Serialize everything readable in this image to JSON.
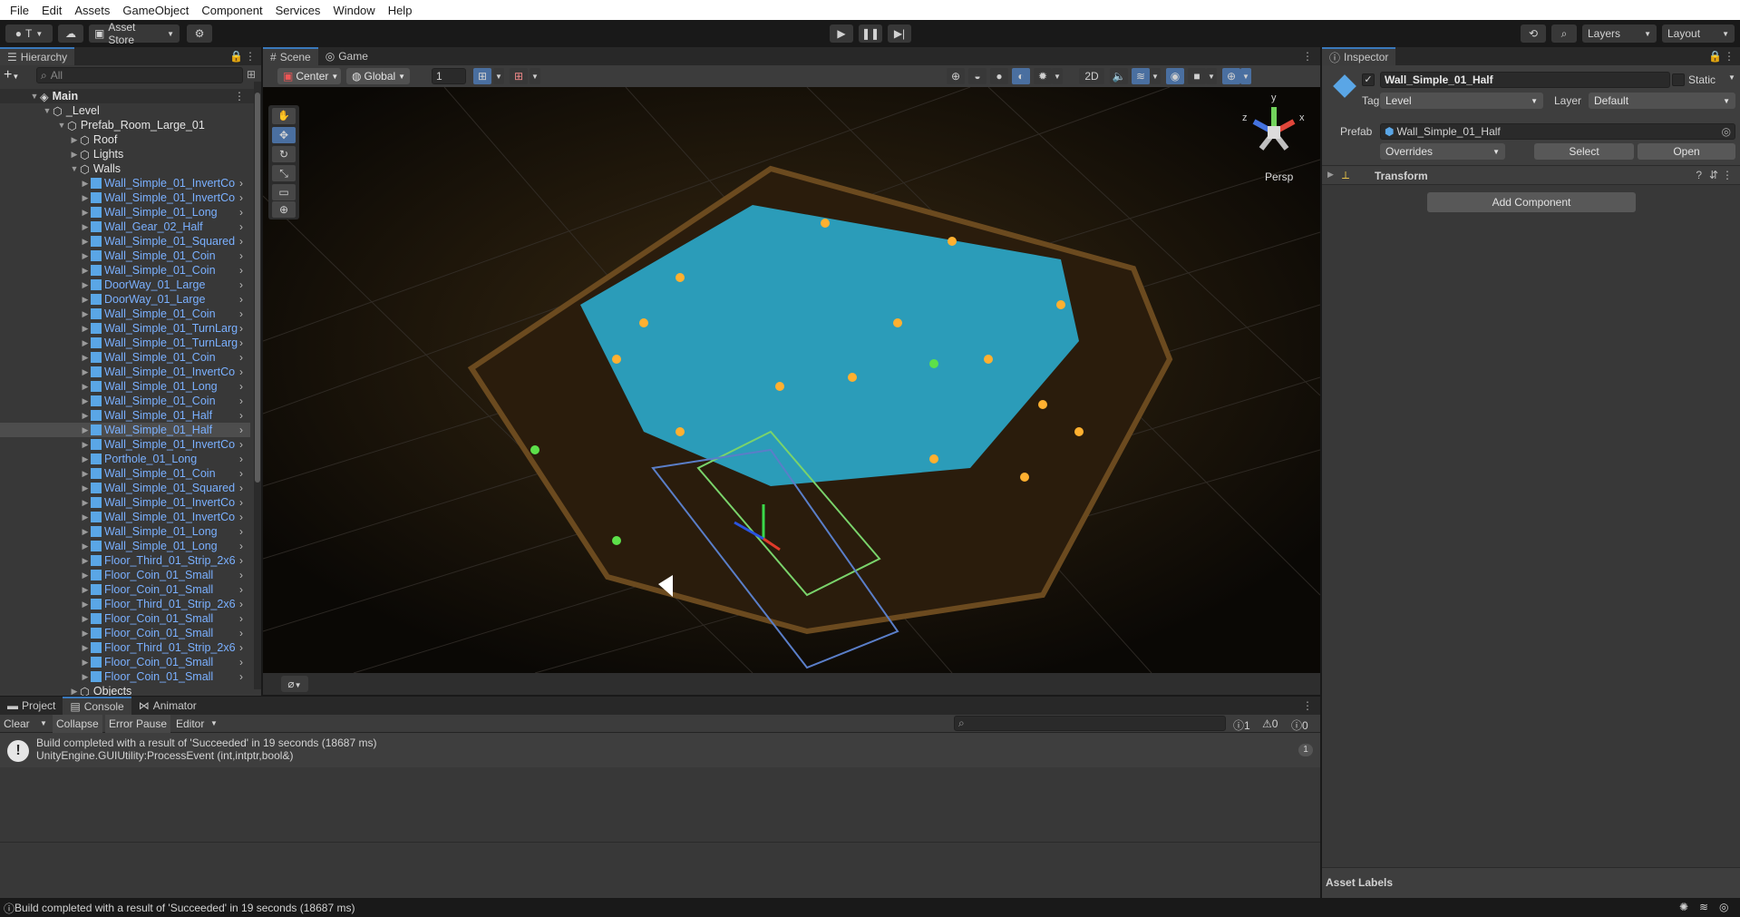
{
  "menu": [
    "File",
    "Edit",
    "Assets",
    "GameObject",
    "Component",
    "Services",
    "Window",
    "Help"
  ],
  "toolbar": {
    "account_label": "T",
    "asset_store_label": "Asset Store",
    "layers_label": "Layers",
    "layout_label": "Layout"
  },
  "hierarchy": {
    "tab_label": "Hierarchy",
    "search_placeholder": "All",
    "root": "Main",
    "level": "_Level",
    "prefab": "Prefab_Room_Large_01",
    "groups": [
      "Roof",
      "Lights",
      "Walls"
    ],
    "items": [
      "Wall_Simple_01_InvertCo",
      "Wall_Simple_01_InvertCo",
      "Wall_Simple_01_Long",
      "Wall_Gear_02_Half",
      "Wall_Simple_01_Squared",
      "Wall_Simple_01_Coin",
      "Wall_Simple_01_Coin",
      "DoorWay_01_Large",
      "DoorWay_01_Large",
      "Wall_Simple_01_Coin",
      "Wall_Simple_01_TurnLarg",
      "Wall_Simple_01_TurnLarg",
      "Wall_Simple_01_Coin",
      "Wall_Simple_01_InvertCo",
      "Wall_Simple_01_Long",
      "Wall_Simple_01_Coin",
      "Wall_Simple_01_Half",
      "Wall_Simple_01_Half",
      "Wall_Simple_01_InvertCo",
      "Porthole_01_Long",
      "Wall_Simple_01_Coin",
      "Wall_Simple_01_Squared",
      "Wall_Simple_01_InvertCo",
      "Wall_Simple_01_InvertCo",
      "Wall_Simple_01_Long",
      "Wall_Simple_01_Long",
      "Floor_Third_01_Strip_2x6",
      "Floor_Coin_01_Small",
      "Floor_Coin_01_Small",
      "Floor_Third_01_Strip_2x6",
      "Floor_Coin_01_Small",
      "Floor_Coin_01_Small",
      "Floor_Third_01_Strip_2x6",
      "Floor_Coin_01_Small",
      "Floor_Coin_01_Small"
    ],
    "selected_index": 17,
    "last_group": "Objects"
  },
  "scene": {
    "tabs": [
      "Scene",
      "Game"
    ],
    "pivot_label": "Center",
    "space_label": "Global",
    "snap_value": "1",
    "mode_2d": "2D",
    "persp_label": "Persp",
    "gizmo_y": "y",
    "gizmo_x": "x",
    "gizmo_z": "z"
  },
  "inspector": {
    "tab_label": "Inspector",
    "object_name": "Wall_Simple_01_Half",
    "static_label": "Static",
    "tag_label": "Tag",
    "tag_value": "Level",
    "layer_label": "Layer",
    "layer_value": "Default",
    "prefab_label": "Prefab",
    "prefab_value": "Wall_Simple_01_Half",
    "overrides_label": "Overrides",
    "select_label": "Select",
    "open_label": "Open",
    "transform_label": "Transform",
    "add_component_label": "Add Component",
    "asset_labels": "Asset Labels"
  },
  "console": {
    "tabs": [
      "Project",
      "Console",
      "Animator"
    ],
    "clear_label": "Clear",
    "collapse_label": "Collapse",
    "error_pause_label": "Error Pause",
    "editor_label": "Editor",
    "count_info": "1",
    "count_warn": "0",
    "count_error": "0",
    "message_line1": "Build completed with a result of 'Succeeded' in 19 seconds (18687 ms)",
    "message_line2": "UnityEngine.GUIUtility:ProcessEvent (int,intptr,bool&)",
    "message_count": "1"
  },
  "status_bar": {
    "message": "Build completed with a result of 'Succeeded' in 19 seconds (18687 ms)"
  },
  "colors": {
    "accent": "#3a79bb",
    "prefab_blue": "#7ab0ff",
    "selected_row": "#4d4d4d",
    "water": "#2bb3d8"
  }
}
